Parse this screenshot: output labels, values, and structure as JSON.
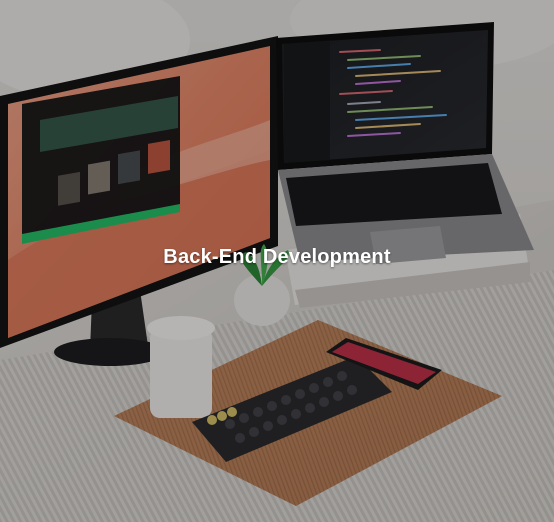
{
  "card": {
    "title": "Back-End Development",
    "image_description_icon": "workspace-photo"
  },
  "colors": {
    "overlay": "#000000",
    "title_text": "#ffffff"
  }
}
